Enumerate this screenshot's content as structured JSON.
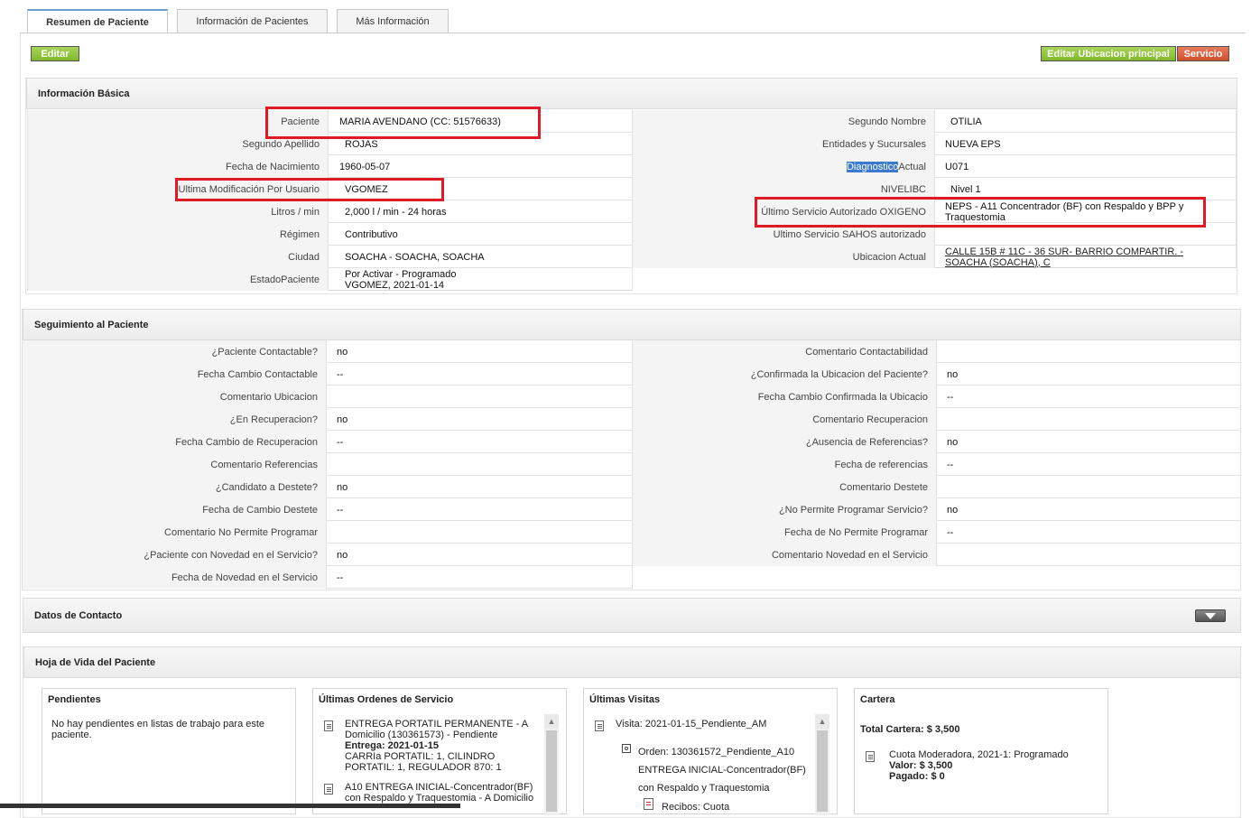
{
  "tabs": [
    "Resumen de Paciente",
    "Información de Pacientes",
    "Más Información"
  ],
  "buttons": {
    "editar": "Editar",
    "editar_ubicacion": "Editar Ubicacion principal",
    "servicio": "Servicio"
  },
  "basic": {
    "title": "Información Básica",
    "left": [
      {
        "label": "Paciente",
        "value": "MARIA AVENDANO (CC: 51576633)"
      },
      {
        "label": "Segundo Apellido",
        "value": "ROJAS"
      },
      {
        "label": "Fecha de Nacimiento",
        "value": "1960-05-07"
      },
      {
        "label": "Ultima Modificación Por Usuario",
        "value": "VGOMEZ"
      },
      {
        "label": "Litros / min",
        "value": "2,000 l / min - 24 horas"
      },
      {
        "label": "Régimen",
        "value": "Contributivo"
      },
      {
        "label": "Ciudad",
        "value": "SOACHA - SOACHA, SOACHA"
      },
      {
        "label": "EstadoPaciente",
        "value": "Por Activar - Programado",
        "value2": "VGOMEZ, 2021-01-14"
      }
    ],
    "right": [
      {
        "label": "Segundo Nombre",
        "value": "OTILIA"
      },
      {
        "label": "Entidades y Sucursales",
        "value": "NUEVA EPS"
      },
      {
        "label": "Diagnostico Actual",
        "label_hl": "Diagnostico",
        "label_rest": " Actual",
        "value": "U071"
      },
      {
        "label": "NIVELIBC",
        "value": "Nivel 1"
      },
      {
        "label": "Último Servicio Autorizado OXIGENO",
        "value": "NEPS - A11 Concentrador (BF) con Respaldo y BPP y",
        "value2": "Traquestomia"
      },
      {
        "label": "Ultimo Servicio SAHOS autorizado",
        "value": ""
      },
      {
        "label": "Ubicacion Actual",
        "value": "CALLE 15B # 11C - 36 SUR- BARRIO COMPARTIR. -",
        "value2": "SOACHA (SOACHA), C"
      }
    ]
  },
  "seguimiento": {
    "title": "Seguimiento al Paciente",
    "left": [
      {
        "label": "¿Paciente Contactable?",
        "value": "no"
      },
      {
        "label": "Fecha Cambio Contactable",
        "value": "--"
      },
      {
        "label": "Comentario Ubicacion",
        "value": ""
      },
      {
        "label": "¿En Recuperacion?",
        "value": "no"
      },
      {
        "label": "Fecha Cambio de Recuperacion",
        "value": "--"
      },
      {
        "label": "Comentario Referencias",
        "value": ""
      },
      {
        "label": "¿Candidato a Destete?",
        "value": "no"
      },
      {
        "label": "Fecha de Cambio Destete",
        "value": "--"
      },
      {
        "label": "Comentario No Permite Programar",
        "value": ""
      },
      {
        "label": "¿Paciente con Novedad en el Servicio?",
        "value": "no"
      },
      {
        "label": "Fecha de Novedad en el Servicio",
        "value": "--"
      }
    ],
    "right": [
      {
        "label": "Comentario Contactabilidad",
        "value": ""
      },
      {
        "label": "¿Confirmada la Ubicacion del Paciente?",
        "value": "no"
      },
      {
        "label": "Fecha Cambio Confirmada la Ubicacio",
        "value": "--"
      },
      {
        "label": "Comentario Recuperacion",
        "value": ""
      },
      {
        "label": "¿Ausencia de Referencias?",
        "value": "no"
      },
      {
        "label": "Fecha de referencias",
        "value": "--"
      },
      {
        "label": "Comentario Destete",
        "value": ""
      },
      {
        "label": "¿No Permite Programar Servicio?",
        "value": "no"
      },
      {
        "label": "Fecha de No Permite Programar",
        "value": "--"
      },
      {
        "label": "Comentario Novedad en el Servicio",
        "value": ""
      }
    ]
  },
  "contacto": {
    "title": "Datos de Contacto"
  },
  "hoja": {
    "title": "Hoja de Vida del Paciente",
    "pendientes": {
      "title": "Pendientes",
      "text1": "No hay pendientes en listas de trabajo para este",
      "text2": "paciente."
    },
    "ordenes": {
      "title": "Últimas Ordenes de Servicio",
      "item1": {
        "l1": "ENTREGA PORTATIL PERMANENTE - A",
        "l2": "Domicilio (130361573) - Pendiente",
        "l3": "Entrega: 2021-01-15",
        "l4": "CARRIa PORTATIL: 1, CILINDRO",
        "l5": "PORTATIL: 1, REGULADOR 870: 1"
      },
      "item2": {
        "l1": "A10 ENTREGA INICIAL-Concentrador(BF)",
        "l2": "con Respaldo y Traquestomia - A Domicilio"
      }
    },
    "visitas": {
      "title": "Últimas Visitas",
      "visita": "Visita: 2021-01-15_Pendiente_AM",
      "orden1": "Orden: 130361572_Pendiente_A10",
      "orden2": "ENTREGA INICIAL-Concentrador(BF)",
      "orden3": "con Respaldo y Traquestomia",
      "recibos": "Recibos: Cuota"
    },
    "cartera": {
      "title": "Cartera",
      "total": "Total Cartera: $ 3,500",
      "cuota": "Cuota Moderadora, 2021-1: Programado",
      "valor": "Valor: $ 3,500",
      "pagado": "Pagado: $ 0"
    }
  },
  "colors": {
    "accent_green": "#8cc63f",
    "accent_red": "#d9532e",
    "highlight_box": "#e01a24",
    "selection": "#3b79d1"
  }
}
